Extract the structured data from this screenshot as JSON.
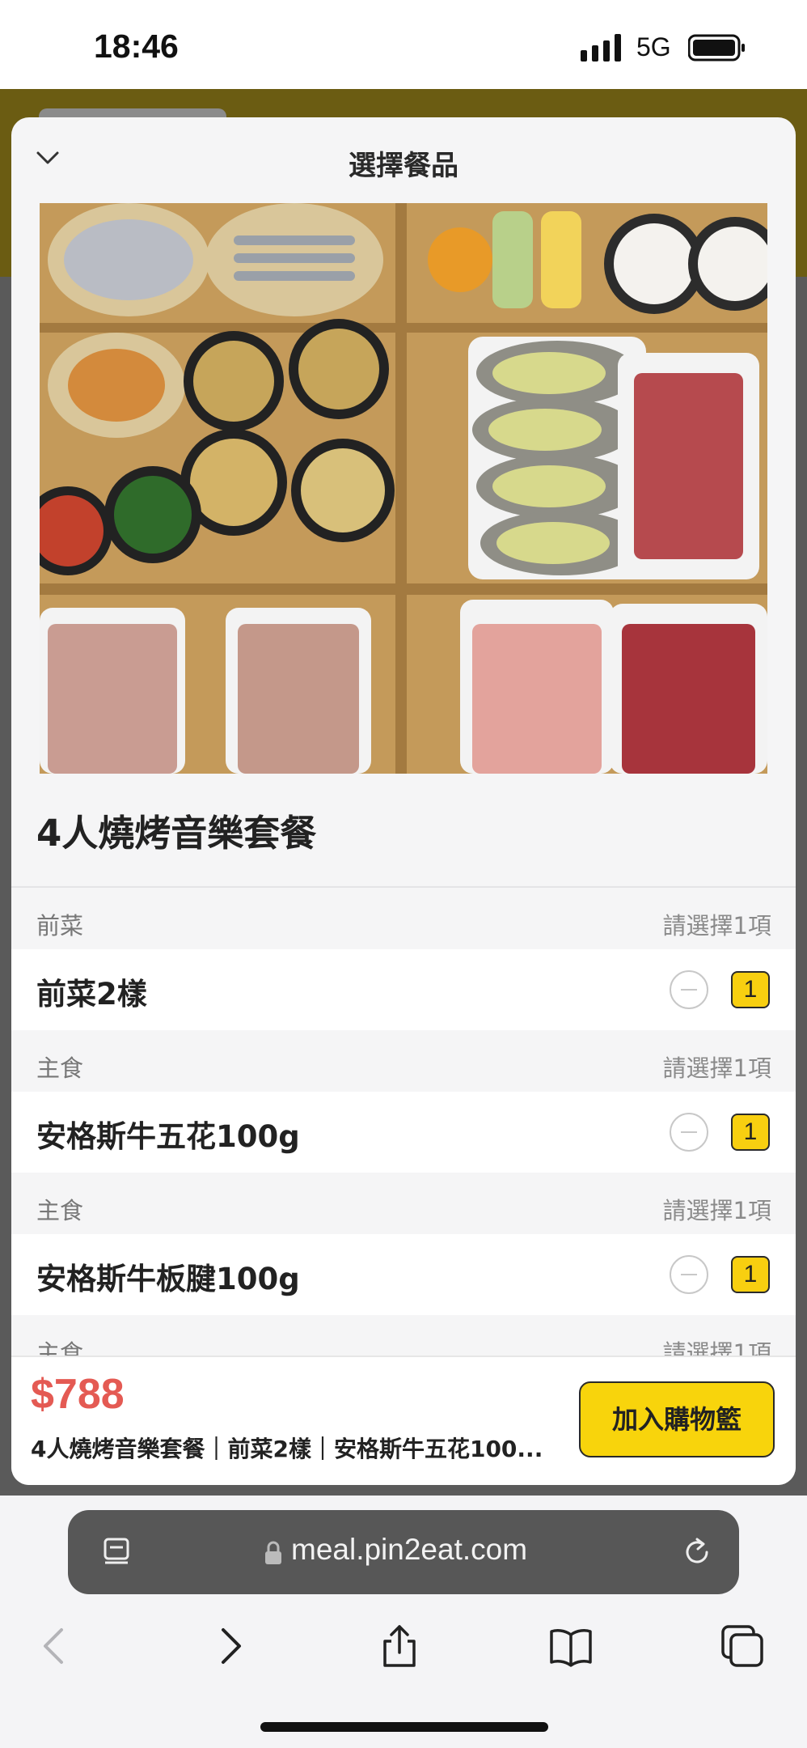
{
  "status_bar": {
    "time": "18:46",
    "network": "5G"
  },
  "sheet": {
    "title": "選擇餐品",
    "set_name": "4人燒烤音樂套餐",
    "groups": [
      {
        "label": "前菜",
        "requirement": "請選擇1項",
        "item": "前菜2樣",
        "quantity": "1"
      },
      {
        "label": "主食",
        "requirement": "請選擇1項",
        "item": "安格斯牛五花100g",
        "quantity": "1"
      },
      {
        "label": "主食",
        "requirement": "請選擇1項",
        "item": "安格斯牛板腱100g",
        "quantity": "1"
      },
      {
        "label": "主食",
        "requirement": "請選擇1項"
      }
    ],
    "price": "$788",
    "summary": "4人燒烤音樂套餐｜前菜2樣｜安格斯牛五花100...",
    "cart_button": "加入購物籃"
  },
  "browser": {
    "url": "meal.pin2eat.com"
  },
  "colors": {
    "accent": "#f8d40c",
    "price": "#e45a53"
  },
  "icons": [
    "chevron-down-icon",
    "signal-icon",
    "battery-icon",
    "reader-icon",
    "lock-icon",
    "reload-icon",
    "back-icon",
    "forward-icon",
    "share-icon",
    "bookmarks-icon",
    "tabs-icon"
  ]
}
